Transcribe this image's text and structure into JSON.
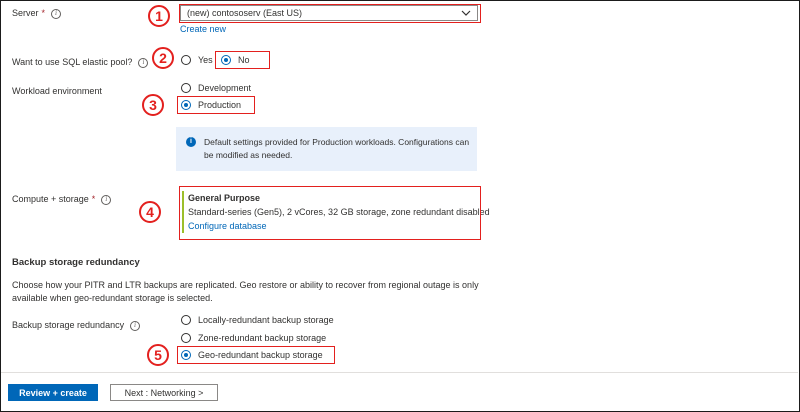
{
  "server": {
    "label": "Server",
    "required_mark": "*",
    "value": "(new) contososerv (East US)",
    "create_new": "Create new"
  },
  "elastic_pool": {
    "label": "Want to use SQL elastic pool?",
    "options": [
      "Yes",
      "No"
    ],
    "selected": "No"
  },
  "workload": {
    "label": "Workload environment",
    "options": [
      "Development",
      "Production"
    ],
    "selected": "Production",
    "info": "Default settings provided for Production workloads. Configurations can be modified as needed."
  },
  "compute": {
    "label": "Compute + storage",
    "required_mark": "*",
    "tier": "General Purpose",
    "description": "Standard-series (Gen5), 2 vCores, 32 GB storage, zone redundant disabled",
    "configure_link": "Configure database"
  },
  "backup": {
    "section_title": "Backup storage redundancy",
    "description": "Choose how your PITR and LTR backups are replicated. Geo restore or ability to recover from regional outage is only available when geo-redundant storage is selected.",
    "label": "Backup storage redundancy",
    "options": [
      "Locally-redundant backup storage",
      "Zone-redundant backup storage",
      "Geo-redundant backup storage"
    ],
    "selected": "Geo-redundant backup storage"
  },
  "callouts": [
    "1",
    "2",
    "3",
    "4",
    "5"
  ],
  "footer": {
    "review_create": "Review + create",
    "next": "Next : Networking >"
  },
  "colors": {
    "accent": "#0067b8",
    "callout_red": "#e3201e",
    "info_background": "#e8f0fb",
    "card_accent": "#9cbf2b"
  },
  "icons": [
    "info-icon",
    "chevron-down-icon",
    "info-circle-icon"
  ]
}
